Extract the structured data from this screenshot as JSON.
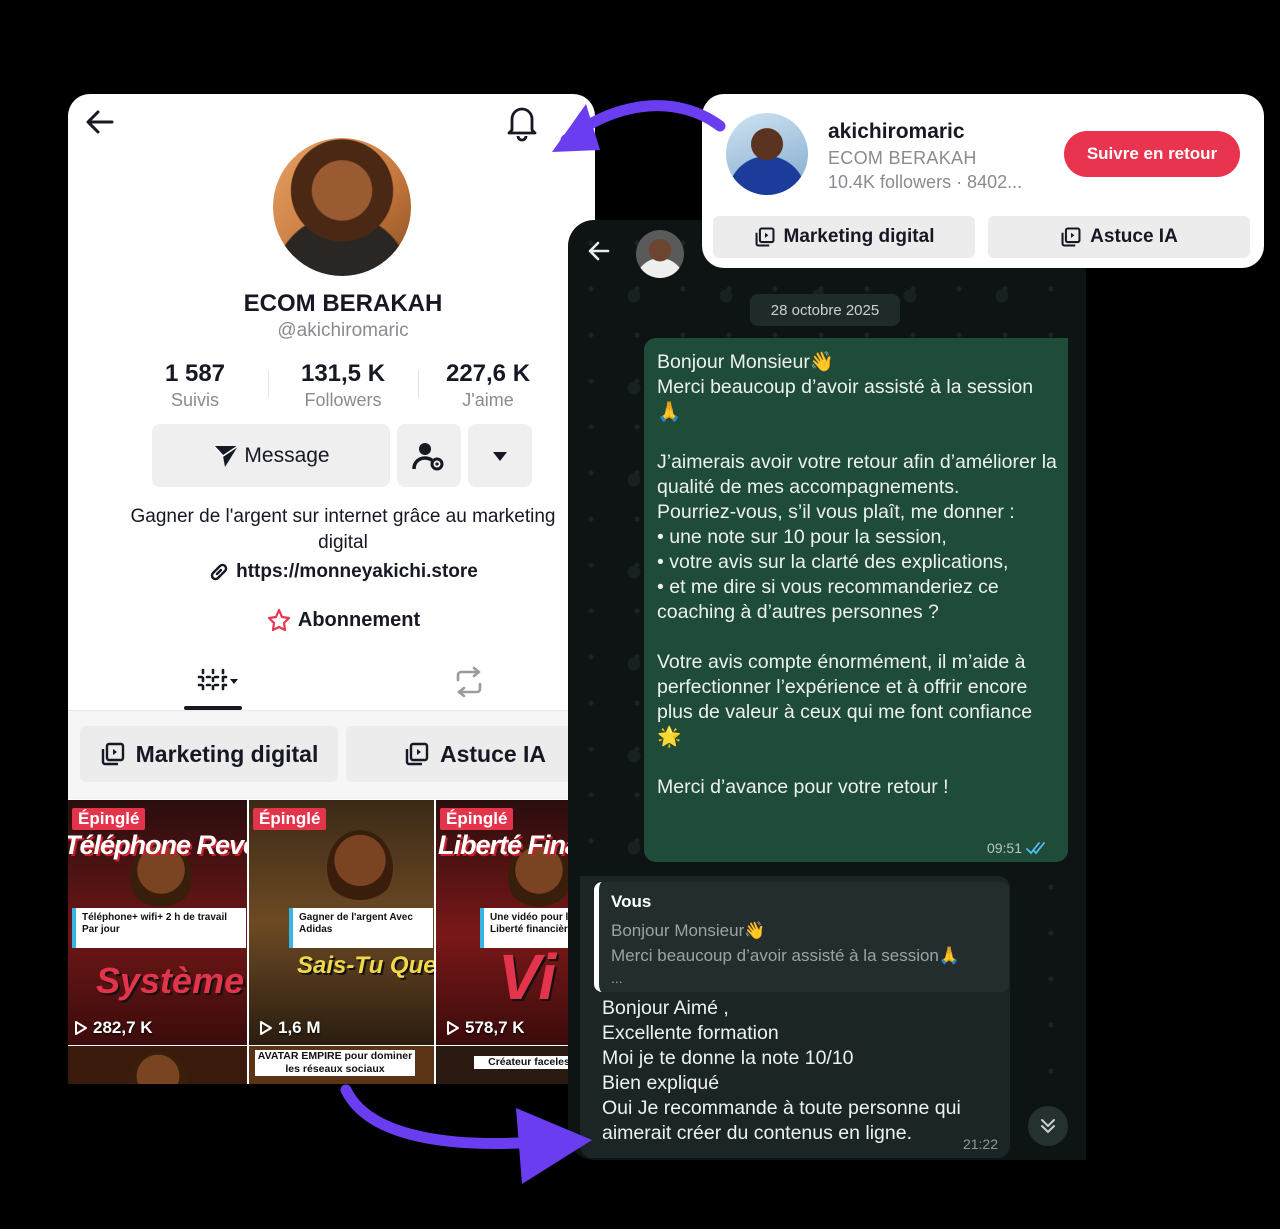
{
  "profile": {
    "name": "ECOM BERAKAH",
    "handle": "@akichiromaric",
    "stats": [
      {
        "value": "1 587",
        "label": "Suivis"
      },
      {
        "value": "131,5 K",
        "label": "Followers"
      },
      {
        "value": "227,6 K",
        "label": "J'aime"
      }
    ],
    "message_label": "Message",
    "bio": "Gagner de l'argent sur internet grâce au marketing digital",
    "link": "https://monneyakichi.store",
    "subscription_label": "Abonnement",
    "playlists": [
      "Marketing digital",
      "Astuce IA"
    ],
    "videos": [
      {
        "tag": "Épinglé",
        "headline": "Téléphone Revenu",
        "card": "Téléphone+ wifi+ 2 h de travail Par jour",
        "promo": "Système",
        "views": "282,7 K"
      },
      {
        "tag": "Épinglé",
        "headline": "",
        "card": "Gagner de l'argent Avec Adidas",
        "promo": "Sais-Tu Que Adidas",
        "views": "1,6 M"
      },
      {
        "tag": "Épinglé",
        "headline": "Liberté Finan",
        "card": "Une vidéo pour la Liberté financière",
        "promo": "Vi",
        "views": "578,7 K"
      }
    ],
    "row2_captions": [
      "",
      "AVATAR EMPIRE pour dominer les réseaux sociaux",
      "Créateur faceles"
    ]
  },
  "popup": {
    "username": "akichiromaric",
    "display_name": "ECOM BERAKAH",
    "meta": "10.4K followers · 8402...",
    "follow_back_label": "Suivre en retour",
    "playlists": [
      "Marketing digital",
      "Astuce IA"
    ]
  },
  "chat": {
    "date": "28 octobre 2025",
    "outgoing": {
      "text": "Bonjour Monsieur👋\nMerci beaucoup d’avoir assisté à la session 🙏\n\nJ’aimerais avoir votre retour afin d’améliorer la qualité de mes accompagnements.\nPourriez-vous, s’il vous plaît, me donner :\n• une note sur 10 pour la session,\n• votre avis sur la clarté des explications,\n• et me dire si vous recommanderiez ce coaching à d’autres personnes ?\n\nVotre avis compte énormément, il m’aide à perfectionner l’expérience et à offrir encore plus de valeur à ceux qui me font confiance 🌟\n\nMerci d’avance pour votre retour !",
      "time": "09:51"
    },
    "incoming": {
      "quote_author": "Vous",
      "quote_line1": "Bonjour Monsieur👋",
      "quote_line2": "Merci beaucoup d’avoir assisté à la session🙏",
      "quote_more": "...",
      "text": "Bonjour Aimé ,\nExcellente formation\nMoi je te donne la note 10/10\nBien expliqué\nOui Je recommande à toute personne qui aimerait créer du contenus en ligne.",
      "time": "21:22"
    }
  },
  "colors": {
    "accent_red": "#e8344e",
    "arrow_purple": "#6a3df0",
    "chat_bubble_out": "#1f4b39",
    "read_tick": "#53bdeb"
  }
}
